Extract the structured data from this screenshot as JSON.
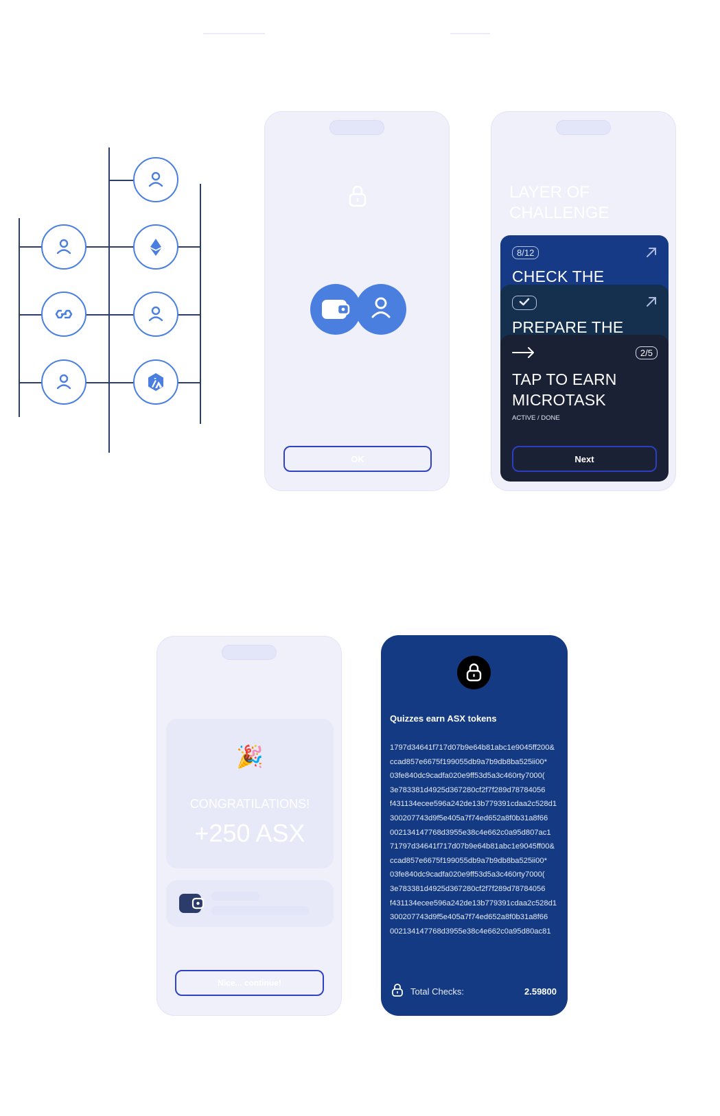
{
  "network": {
    "nodes": [
      {
        "icon": "user-icon"
      },
      {
        "icon": "ethereum-icon"
      },
      {
        "icon": "user-icon"
      },
      {
        "icon": "arbitrum-icon"
      },
      {
        "icon": "user-icon"
      },
      {
        "icon": "polygon-icon"
      },
      {
        "icon": "user-icon"
      }
    ]
  },
  "connect_screen": {
    "lock_icon": "lock-icon",
    "wallet_icon": "wallet-icon",
    "user_icon": "user-icon",
    "ok_label": "OK"
  },
  "challenge_screen": {
    "title_line1": "LAYER OF",
    "title_line2": "CHALLENGE",
    "cards": [
      {
        "badge": "8/12",
        "title": "CHECK THE"
      },
      {
        "badge": "check",
        "title": "PREPARE THE"
      },
      {
        "badge": "2/5",
        "title_line1": "TAP TO EARN",
        "title_line2": "MICROTASK",
        "status": "ACTIVE / DONE"
      }
    ],
    "next_label": "Next"
  },
  "reward_screen": {
    "emoji": "🎉",
    "congrats": "CONGRATILATIONS!",
    "amount": "+250 ASX",
    "continue_label": "Nice... continue!"
  },
  "token_screen": {
    "heading": "Quizzes earn ASX tokens",
    "hashes": [
      "1797d34641f717d07b9e64b81abc1e9045ff200&",
      "ccad857e6675f199055db9a7b9db8ba525ii00*",
      "03fe840dc9cadfa020e9ff53d5a3c460rty7000(",
      "3e783381d4925d367280cf2f7f289d78784056",
      "f431134ecee596a242de13b779391cdaa2c528d1",
      "300207743d9f5e405a7f74ed652a8f0b31a8f66",
      "002134147768d3955e38c4e662c0a95d807ac1",
      "71797d34641f717d07b9e64b81abc1e9045ff00&",
      "ccad857e6675f199055db9a7b9db8ba525ii00*",
      "03fe840dc9cadfa020e9ff53d5a3c460rty7000(",
      "3e783381d4925d367280cf2f7f289d78784056",
      "f431134ecee596a242de13b779391cdaa2c528d1",
      "300207743d9f5e405a7f74ed652a8f0b31a8f66",
      "002134147768d3955e38c4e662c0a95d80ac81"
    ],
    "total_label": "Total Checks:",
    "total_value": "2.59800"
  },
  "colors": {
    "accent_blue": "#4a7fe0",
    "navy": "#133a82",
    "dark_card": "#1b2135",
    "button_border": "#2f42c4"
  }
}
